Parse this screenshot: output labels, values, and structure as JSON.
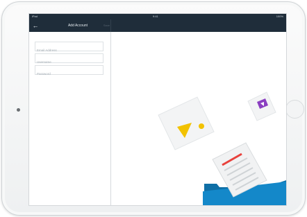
{
  "status_bar": {
    "carrier": "iPad",
    "time": "9:41",
    "battery": "100%"
  },
  "nav_bar": {
    "title": "Add Account",
    "save_label": "Save"
  },
  "form": {
    "email_placeholder": "Email Address",
    "username_placeholder": "Username",
    "password_placeholder": "Password"
  },
  "colors": {
    "nav_background": "#1f2d3a",
    "accent_yellow": "#f2c200",
    "accent_purple": "#8b3fc1",
    "accent_blue": "#1488c9",
    "accent_red": "#e8413c"
  }
}
